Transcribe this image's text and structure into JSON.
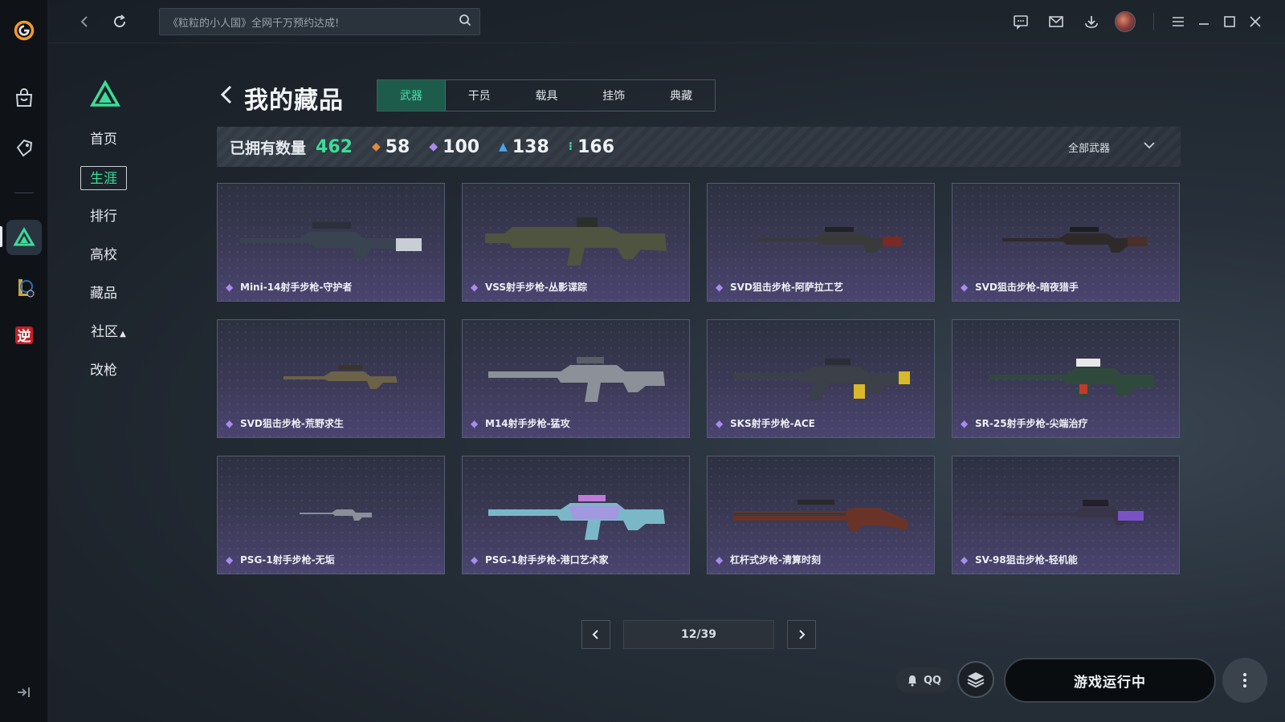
{
  "search": {
    "placeholder": "《粒粒的小人国》全网千万预约达成!"
  },
  "subnav": {
    "items": [
      {
        "label": "首页"
      },
      {
        "label": "生涯"
      },
      {
        "label": "排行"
      },
      {
        "label": "高校"
      },
      {
        "label": "藏品"
      },
      {
        "label": "社区"
      },
      {
        "label": "改枪"
      }
    ],
    "active": "生涯"
  },
  "header": {
    "title": "我的藏品",
    "tabs": [
      "武器",
      "干员",
      "载具",
      "挂饰",
      "典藏"
    ],
    "active_tab": "武器"
  },
  "stats": {
    "owned_label": "已拥有数量",
    "owned_value": "462",
    "counts": [
      {
        "value": "58",
        "color": "#e08a3c"
      },
      {
        "value": "100",
        "color": "#a98bf0"
      },
      {
        "value": "138",
        "color": "#4fa3e8"
      },
      {
        "value": "166",
        "color": "#3ddc97"
      }
    ],
    "filter_label": "全部武器"
  },
  "items": [
    {
      "name": "Mini-14射手步枪-守护者"
    },
    {
      "name": "VSS射手步枪-丛影谍踪"
    },
    {
      "name": "SVD狙击步枪-阿萨拉工艺"
    },
    {
      "name": "SVD狙击步枪-暗夜猎手"
    },
    {
      "name": "SVD狙击步枪-荒野求生"
    },
    {
      "name": "M14射手步枪-猛攻"
    },
    {
      "name": "SKS射手步枪-ACE"
    },
    {
      "name": "SR-25射手步枪-尖端治疗"
    },
    {
      "name": "PSG-1射手步枪-无垢"
    },
    {
      "name": "PSG-1射手步枪-港口艺术家"
    },
    {
      "name": "杠杆式步枪-清算时刻"
    },
    {
      "name": "SV-98狙击步枪-轻机能"
    }
  ],
  "pagination": {
    "current": "12/39"
  },
  "bottom": {
    "qq_label": "QQ",
    "launch_label": "游戏运行中"
  },
  "colors": {
    "accent": "#3ddc97",
    "rarity_purple": "#a98bf0",
    "card_bg": "#3c3a57"
  },
  "icons": {
    "rail": [
      "app-logo-icon",
      "store-icon",
      "tag-icon",
      "game-delta-icon",
      "league-icon",
      "ni-game-icon",
      "collapse-icon"
    ],
    "topbar": [
      "back-icon",
      "refresh-icon",
      "search-icon",
      "chat-icon",
      "mail-icon",
      "download-icon",
      "menu-icon",
      "minimize-icon",
      "maximize-icon",
      "close-icon"
    ]
  }
}
